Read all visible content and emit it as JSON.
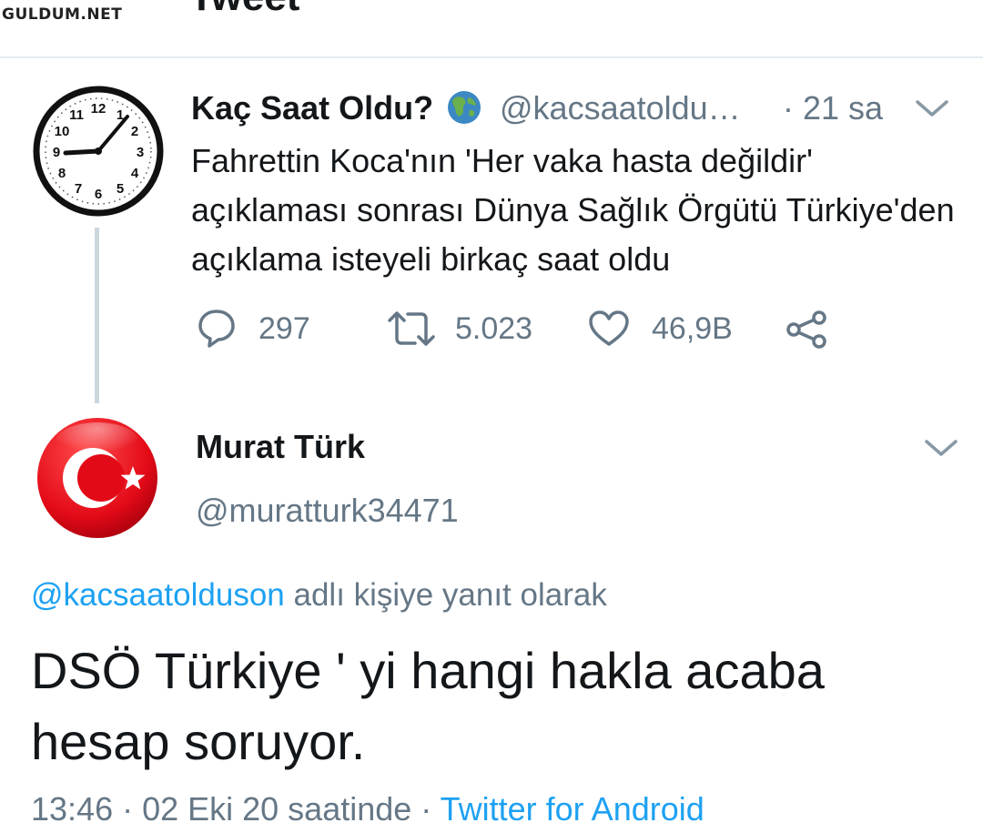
{
  "header": {
    "title": "Tweet",
    "watermark": "GULDUM.NET"
  },
  "parent_tweet": {
    "avatar_icon": "clock-icon",
    "display_name": "Kaç Saat Oldu?",
    "name_emoji_icon": "globe-emoji-icon",
    "handle": "@kacsaatoldu…",
    "separator": "·",
    "time": "21 sa",
    "text": "Fahrettin Koca'nın 'Her vaka hasta değildir' açıklaması sonrası Dünya Sağlık Örgütü Türkiye'den açıklama isteyeli birkaç saat oldu",
    "actions": {
      "reply_count": "297",
      "retweet_count": "5.023",
      "like_count": "46,9B"
    }
  },
  "reply_tweet": {
    "avatar_icon": "turkish-flag-icon",
    "display_name": "Murat Türk",
    "handle": "@muratturk34471",
    "replying_mention": "@kacsaatolduson",
    "replying_suffix": " adlı kişiye yanıt olarak",
    "text": "DSÖ Türkiye ' yi hangi hakla acaba hesap soruyor.",
    "timestamp": "13:46 · 02 Eki 20 saatinde · ",
    "source": "Twitter for Android"
  },
  "colors": {
    "link": "#1da1f2",
    "secondary_text": "#657786",
    "divider": "#e6ecf0",
    "flag_red": "#e30a17"
  }
}
